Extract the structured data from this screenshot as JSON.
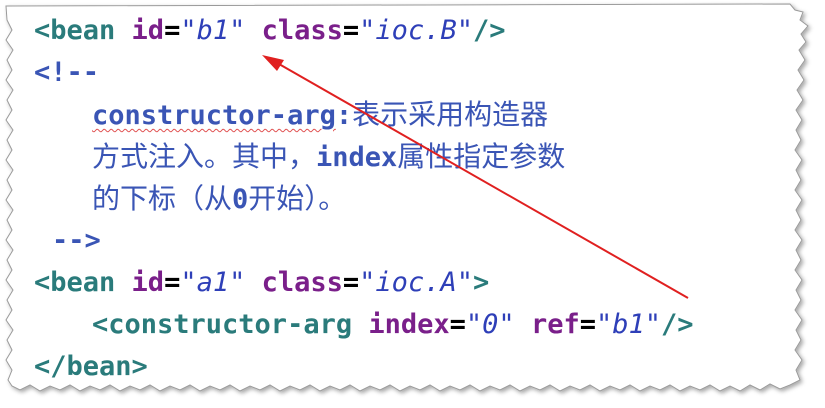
{
  "code": {
    "line1": {
      "open": "<bean",
      "id_attr": "id",
      "id_val": "\"b1\"",
      "class_attr": "class",
      "class_val": "\"ioc.B\"",
      "close": "/>"
    },
    "line2": {
      "text": "<!--"
    },
    "line3": {
      "keyword": "constructor-arg",
      "colon": ":",
      "cjk": "表示采用构造器"
    },
    "line4": {
      "cjk_a": "方式注入。其中，",
      "keyword": "index",
      "cjk_b": "属性指定参数"
    },
    "line5": {
      "cjk_a": "的下标（从",
      "num": "0",
      "cjk_b": "开始）。"
    },
    "line6": {
      "text": "-->"
    },
    "line7": {
      "open": "<bean",
      "id_attr": "id",
      "id_val": "\"a1\"",
      "class_attr": "class",
      "class_val": "\"ioc.A\"",
      "close": ">"
    },
    "line8": {
      "open": "<constructor-arg",
      "index_attr": "index",
      "index_val": "\"0\"",
      "ref_attr": "ref",
      "ref_val": "\"b1\"",
      "close": "/>"
    },
    "line9": {
      "text": "</bean>"
    }
  },
  "colors": {
    "tag": "#2a7b7b",
    "attribute": "#7a1f8a",
    "string": "#2e3fb8",
    "comment": "#3a55b5",
    "annotation_arrow": "#e02020"
  }
}
